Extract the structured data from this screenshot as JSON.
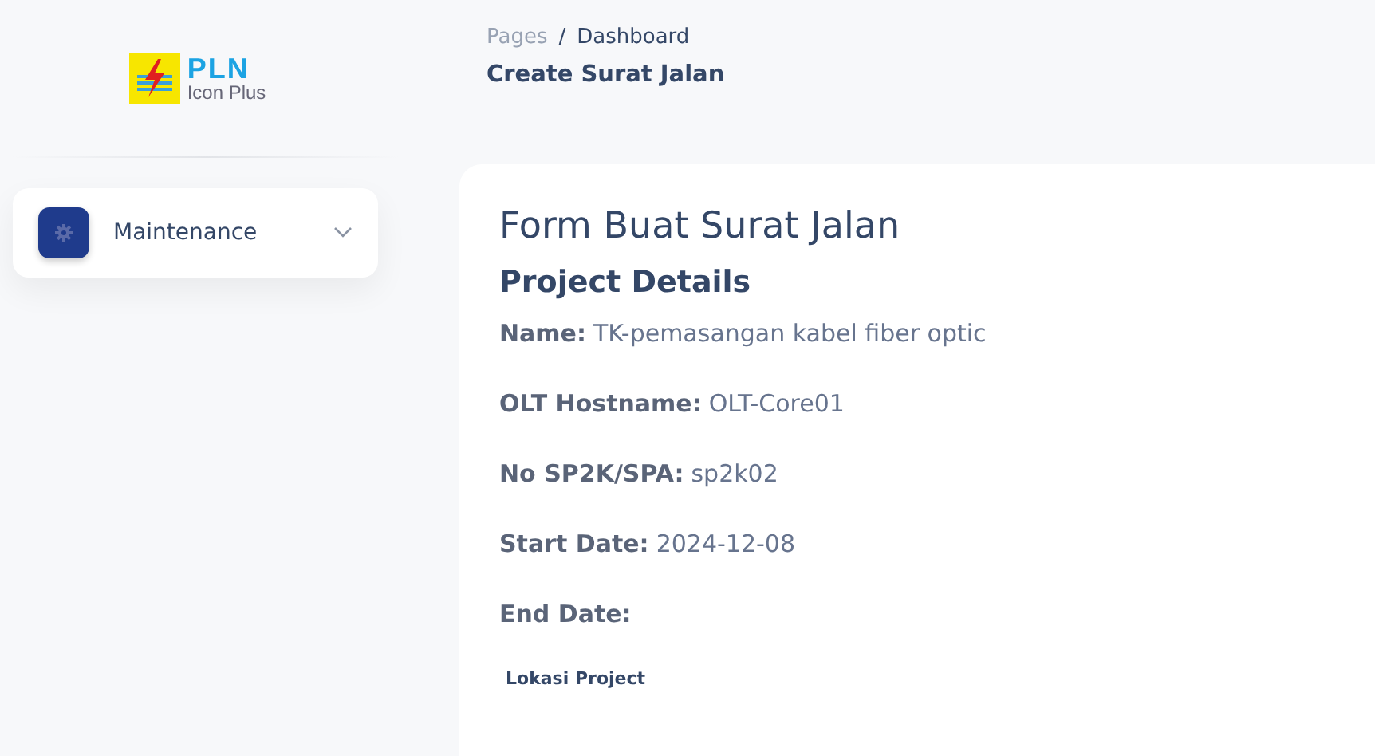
{
  "logo": {
    "title": "PLN",
    "subtitle": "Icon Plus"
  },
  "sidebar": {
    "items": [
      {
        "label": "Maintenance",
        "expanded": false
      }
    ]
  },
  "breadcrumb": {
    "items": [
      "Pages",
      "Dashboard"
    ],
    "separator": "/"
  },
  "page_title": "Create Surat Jalan",
  "form": {
    "title": "Form Buat Surat Jalan",
    "section": "Project Details",
    "details": [
      {
        "label": "Name:",
        "value": "TK-pemasangan kabel fiber optic"
      },
      {
        "label": "OLT Hostname:",
        "value": "OLT-Core01"
      },
      {
        "label": "No SP2K/SPA:",
        "value": "sp2k02"
      },
      {
        "label": "Start Date:",
        "value": "2024-12-08"
      },
      {
        "label": "End Date:"
      }
    ],
    "subsection": "Lokasi Project"
  }
}
